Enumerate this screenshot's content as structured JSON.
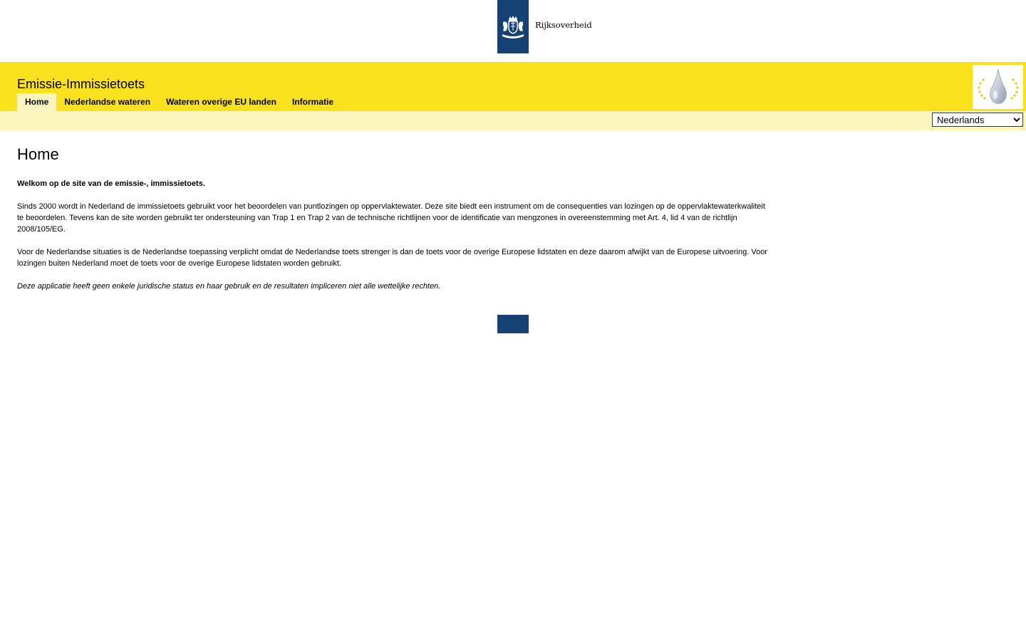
{
  "header": {
    "brand_wordmark": "Rijksoverheid",
    "logo_icon": "rijksoverheid-coat-of-arms-icon",
    "brand_color": "#154273"
  },
  "app": {
    "title": "Emissie-Immissietoets",
    "logo_icon": "water-drop-eu-stars-icon"
  },
  "nav": {
    "items": [
      {
        "label": "Home",
        "active": true
      },
      {
        "label": "Nederlandse wateren",
        "active": false
      },
      {
        "label": "Wateren overige EU landen",
        "active": false
      },
      {
        "label": "Informatie",
        "active": false
      }
    ]
  },
  "language": {
    "selected": "Nederlands"
  },
  "main": {
    "heading": "Home",
    "welcome": "Welkom op de site van de emissie-, immissietoets.",
    "paragraph_1": "Sinds 2000 wordt in Nederland de immissietoets gebruikt voor het beoordelen van puntlozingen op oppervlaktewater. Deze site biedt een instrument om de consequenties van lozingen op de oppervlaktewaterkwaliteit te beoordelen. Tevens kan de site worden gebruikt ter ondersteuning van Trap 1 en Trap 2 van de technische richtlijnen voor de identificatie van mengzones in overeenstemming met Art. 4, lid 4 van de richtlijn 2008/105/EG.",
    "paragraph_2": "Voor de Nederlandse situaties is de Nederlandse toepassing verplicht omdat de Nederlandse toets strenger is dan de toets voor de overige Europese lidstaten en deze daarom afwijkt van de Europese uitvoering. Voor lozingen buiten Nederland moet de toets voor de overige Europese lidstaten worden gebruikt.",
    "disclaimer": "Deze applicatie heeft geen enkele juridische status en haar gebruik en de resultaten impliceren niet alle wettelijke rechten."
  },
  "colors": {
    "yellow": "#f9e11e",
    "light_yellow": "#fbf5bd",
    "navy": "#154273"
  }
}
